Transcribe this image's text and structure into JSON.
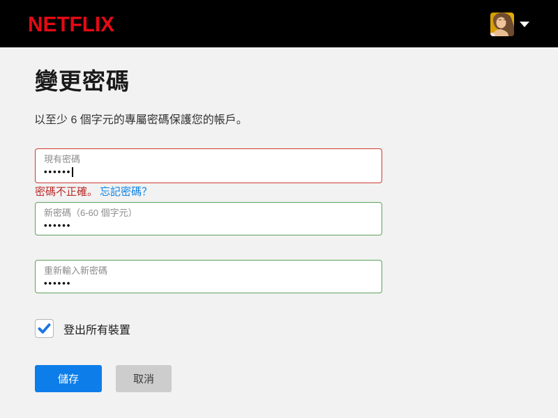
{
  "header": {
    "brand": "NETFLIX",
    "avatar": "profile-avatar",
    "caret": "chevron-down"
  },
  "page": {
    "title": "變更密碼",
    "subtitle": "以至少 6 個字元的專屬密碼保護您的帳戶。"
  },
  "form": {
    "current_password": {
      "label": "現有密碼",
      "value_masked": "••••••",
      "state": "error"
    },
    "error_text": "密碼不正確。",
    "forgot_link": "忘記密碼？",
    "new_password": {
      "label": "新密碼（6-60 個字元）",
      "value_masked": "••••••",
      "state": "valid"
    },
    "confirm_password": {
      "label": "重新輸入新密碼",
      "value_masked": "••••••",
      "state": "valid"
    },
    "signout_checkbox": {
      "label": "登出所有裝置",
      "checked": true
    },
    "save_button": "儲存",
    "cancel_button": "取消"
  },
  "theme": {
    "header_bg": "#000000",
    "brand_red": "#e50914",
    "page_bg": "#f2f2f2",
    "error_border": "#cb3a32",
    "valid_border": "#5ea15b",
    "error_text_color": "#b92d2b",
    "link_color": "#0a84e8",
    "checkbox_check_color": "#1b76e3",
    "save_button_bg": "#0d7de9",
    "cancel_button_bg": "#cdcdcd"
  }
}
